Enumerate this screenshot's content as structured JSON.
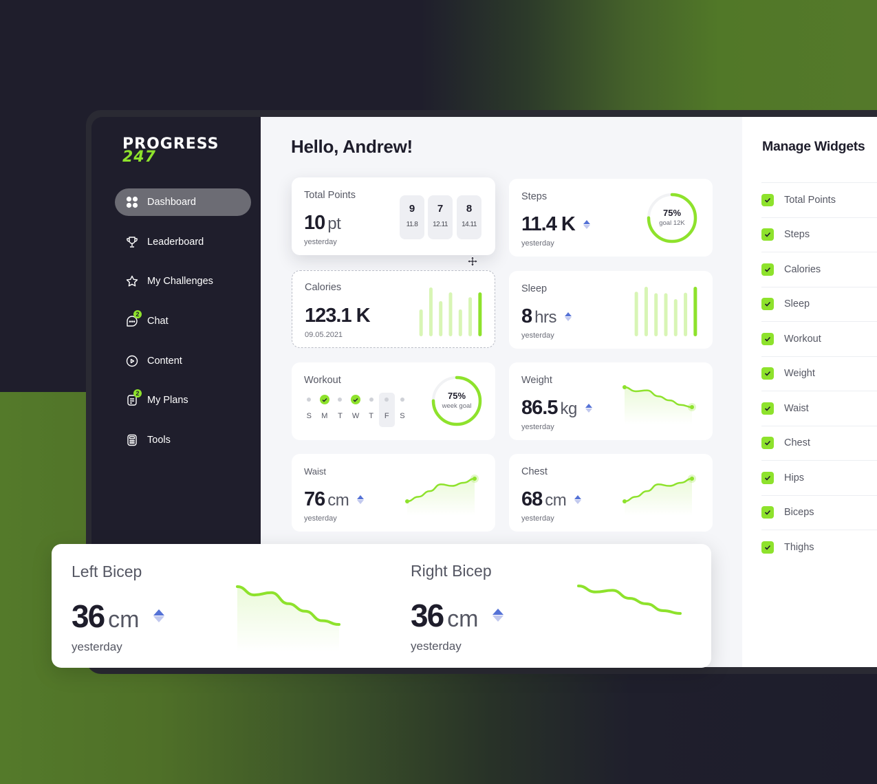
{
  "app": {
    "logo_line1": "PROGRESS",
    "logo_line2": "247",
    "accent_color": "#8ee22c",
    "secondary_accent": "#5572d6"
  },
  "sidebar": {
    "items": [
      {
        "label": "Dashboard",
        "icon": "grid-icon",
        "active": true
      },
      {
        "label": "Leaderboard",
        "icon": "trophy-icon"
      },
      {
        "label": "My Challenges",
        "icon": "star-icon"
      },
      {
        "label": "Chat",
        "icon": "chat-icon",
        "badge": "2"
      },
      {
        "label": "Content",
        "icon": "play-circle-icon"
      },
      {
        "label": "My Plans",
        "icon": "document-icon",
        "badge": "2"
      },
      {
        "label": "Tools",
        "icon": "calculator-icon"
      }
    ]
  },
  "main": {
    "greeting": "Hello, Andrew!",
    "cards": {
      "total_points": {
        "title": "Total Points",
        "value": "10",
        "unit": "pt",
        "sub": "yesterday",
        "history": [
          {
            "points": "9",
            "date": "11.8"
          },
          {
            "points": "7",
            "date": "12.11"
          },
          {
            "points": "8",
            "date": "14.11"
          }
        ]
      },
      "steps": {
        "title": "Steps",
        "value": "11.4 K",
        "sub": "yesterday",
        "progress_pct": "75%",
        "progress": 0.75,
        "goal_label": "goal 12K"
      },
      "calories": {
        "title": "Calories",
        "value": "123.1 K",
        "sub": "09.05.2021",
        "bars": [
          0.55,
          1.0,
          0.72,
          0.9,
          0.55,
          0.8,
          0.9
        ]
      },
      "sleep": {
        "title": "Sleep",
        "value": "8",
        "unit": "hrs",
        "sub": "yesterday",
        "bars": [
          0.9,
          1.0,
          0.87,
          0.87,
          0.75,
          0.88,
          1.0
        ]
      },
      "workout": {
        "title": "Workout",
        "progress_pct": "75%",
        "progress": 0.75,
        "goal_label": "week goal",
        "days": [
          {
            "label": "S",
            "done": false
          },
          {
            "label": "M",
            "done": true
          },
          {
            "label": "T",
            "done": false
          },
          {
            "label": "W",
            "done": true
          },
          {
            "label": "T",
            "done": false
          },
          {
            "label": "F",
            "done": false,
            "selected": true
          },
          {
            "label": "S",
            "done": false
          }
        ]
      },
      "weight": {
        "title": "Weight",
        "value": "86.5",
        "unit": "kg",
        "sub": "yesterday",
        "trend": [
          1.0,
          0.82,
          0.86,
          0.6,
          0.42,
          0.22,
          0.12
        ]
      },
      "waist": {
        "title": "Waist",
        "value": "76",
        "unit": "cm",
        "sub": "yesterday",
        "trend": [
          0.0,
          0.2,
          0.45,
          0.75,
          0.68,
          0.82,
          1.0
        ]
      },
      "chest": {
        "title": "Chest",
        "value": "68",
        "unit": "cm",
        "sub": "yesterday",
        "trend": [
          0.0,
          0.2,
          0.45,
          0.75,
          0.68,
          0.82,
          1.0
        ]
      }
    }
  },
  "biceps": {
    "left": {
      "title": "Left Bicep",
      "value": "36",
      "unit": "cm",
      "sub": "yesterday",
      "trend": [
        1.0,
        0.78,
        0.84,
        0.55,
        0.35,
        0.1,
        0.0
      ]
    },
    "right": {
      "title": "Right Bicep",
      "value": "36",
      "unit": "cm",
      "sub": "yesterday",
      "trend": [
        1.0,
        0.78,
        0.84,
        0.55,
        0.35,
        0.1,
        0.0
      ]
    }
  },
  "widgets": {
    "title": "Manage Widgets",
    "items": [
      {
        "label": "Total Points",
        "checked": true
      },
      {
        "label": "Steps",
        "checked": true
      },
      {
        "label": "Calories",
        "checked": true
      },
      {
        "label": "Sleep",
        "checked": true
      },
      {
        "label": "Workout",
        "checked": true
      },
      {
        "label": "Weight",
        "checked": true
      },
      {
        "label": "Waist",
        "checked": true
      },
      {
        "label": "Chest",
        "checked": true
      },
      {
        "label": "Hips",
        "checked": true
      },
      {
        "label": "Biceps",
        "checked": true
      },
      {
        "label": "Thighs",
        "checked": true
      }
    ]
  }
}
